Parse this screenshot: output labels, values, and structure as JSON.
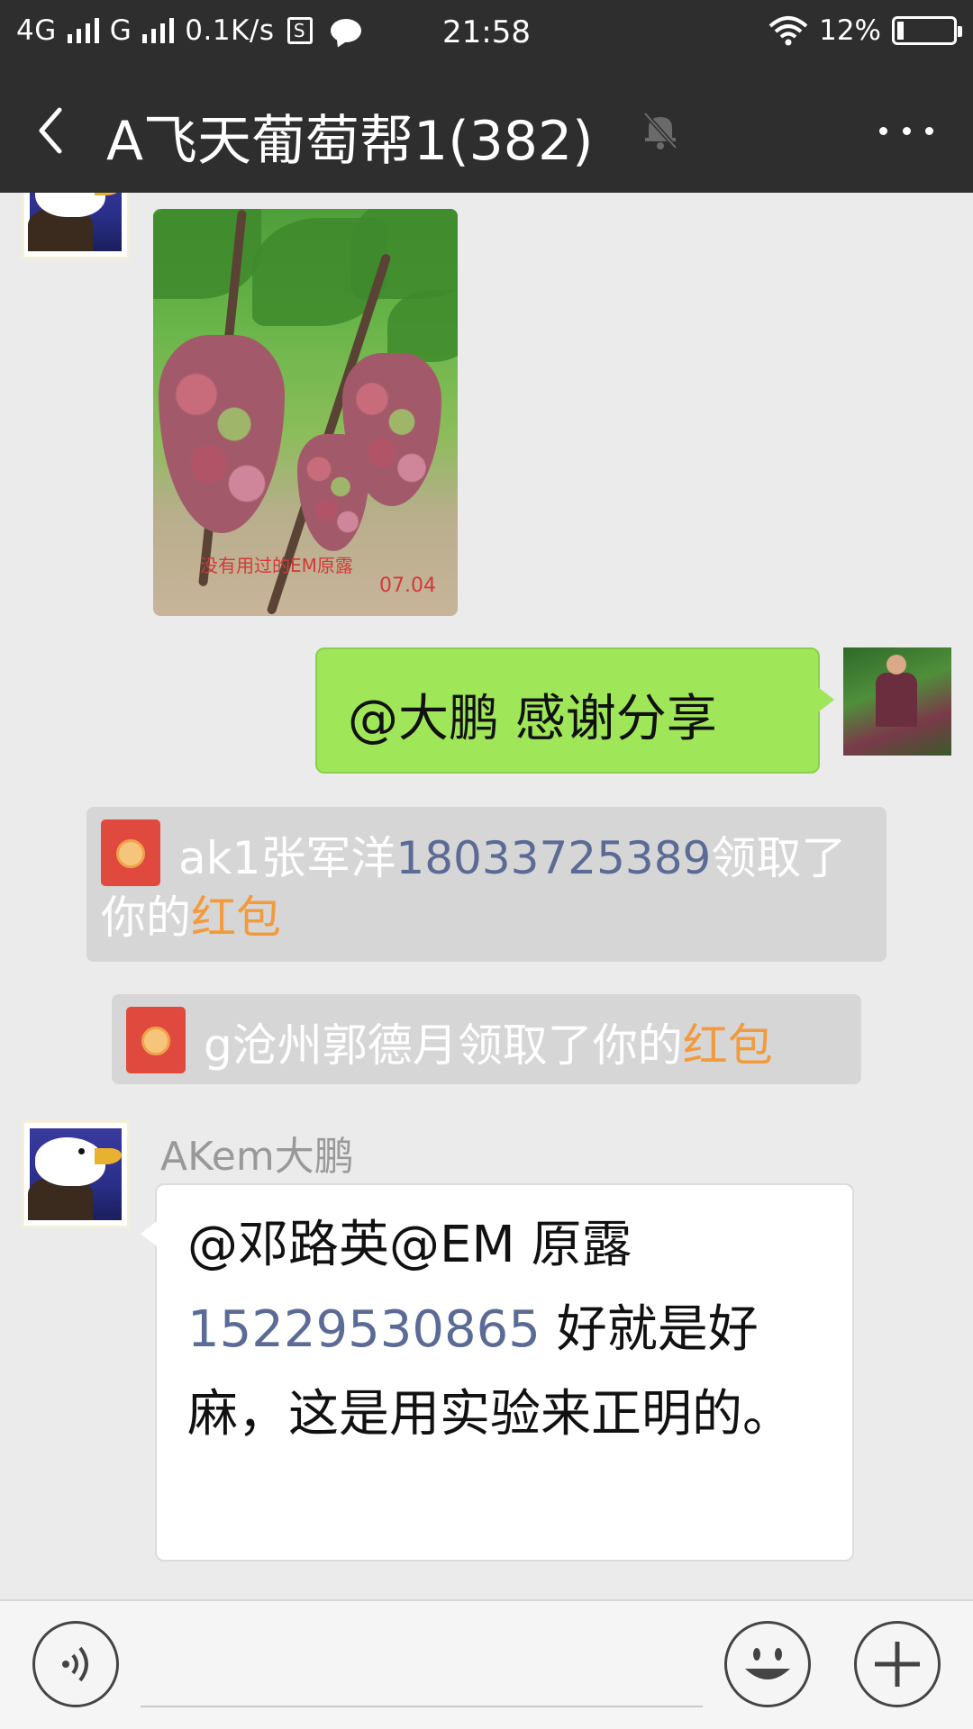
{
  "status_bar": {
    "network_1": "4G",
    "network_2": "G",
    "speed": "0.1K/s",
    "sim_icon_letter": "S",
    "time": "21:58",
    "battery": "12%"
  },
  "header": {
    "title": "A飞天葡萄帮1(382)",
    "back_icon": "chevron-left-icon",
    "mute_icon": "muted-bell-icon",
    "more_icon": "more-dots-icon"
  },
  "messages": {
    "photo": {
      "caption": "没有用过的EM原露",
      "date": "07.04"
    },
    "self_text": "@大鹏  感谢分享",
    "sys1": {
      "prefix": "ak1张军洋",
      "phone": "18033725389",
      "mid": "领取了你的",
      "suffix": "红包"
    },
    "sys2": {
      "prefix": "g沧州郭德月领取了你的",
      "suffix": "红包"
    },
    "incoming": {
      "sender": "AKem大鹏",
      "text_1": "@邓路英@EM 原露",
      "phone": "15229530865",
      "text_2": " 好就是好麻，这是用实验来正明的。"
    }
  },
  "input_bar": {
    "voice_icon": "voice-icon",
    "emoji_icon": "emoji-icon",
    "plus_icon": "plus-icon"
  },
  "colors": {
    "topbar": "#2e2e2e",
    "chat_bg": "#ebebeb",
    "self_bubble": "#9fe658",
    "link_blue": "#5b6b96",
    "redpacket_orange": "#f29a3c"
  }
}
